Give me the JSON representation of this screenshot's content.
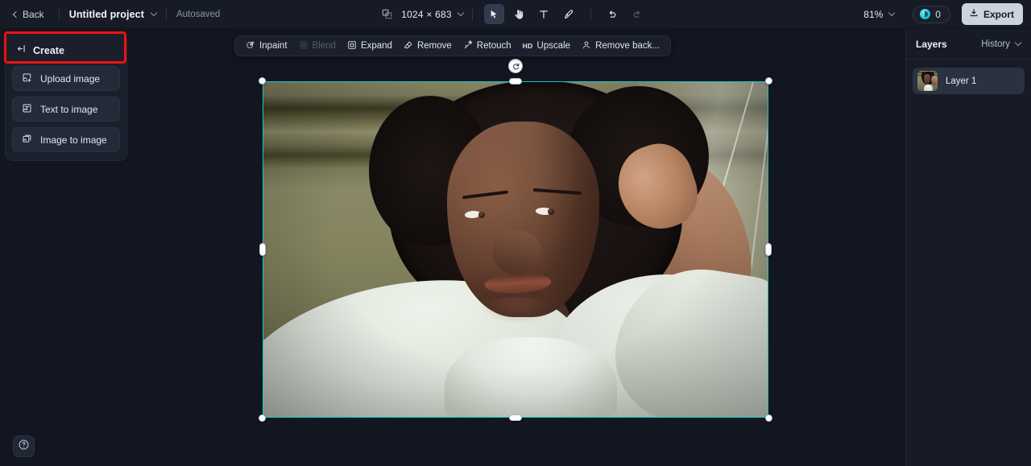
{
  "topbar": {
    "back_label": "Back",
    "project_name": "Untitled project",
    "autosaved_label": "Autosaved",
    "canvas_size": "1024 × 683",
    "zoom_level": "81%",
    "credits_count": "0",
    "export_label": "Export",
    "tools": [
      {
        "name": "select-tool",
        "glyph": "cursor",
        "active": true,
        "disabled": false
      },
      {
        "name": "pan-tool",
        "glyph": "hand",
        "active": false,
        "disabled": false
      },
      {
        "name": "text-tool",
        "glyph": "T",
        "active": false,
        "disabled": false
      },
      {
        "name": "brush-tool",
        "glyph": "brush",
        "active": false,
        "disabled": false
      },
      {
        "name": "undo-button",
        "glyph": "undo",
        "active": false,
        "disabled": false
      },
      {
        "name": "redo-button",
        "glyph": "redo",
        "active": false,
        "disabled": true
      }
    ]
  },
  "create_panel": {
    "title": "Create",
    "collapse_icon": "collapse-panel-icon",
    "items": [
      {
        "label": "Upload image",
        "icon": "image-plus-icon",
        "highlighted": true
      },
      {
        "label": "Text to image",
        "icon": "text-to-image-icon",
        "highlighted": false
      },
      {
        "label": "Image to image",
        "icon": "image-to-image-icon",
        "highlighted": false
      }
    ]
  },
  "edit_toolbar": {
    "items": [
      {
        "label": "Inpaint",
        "icon": "inpaint-icon",
        "disabled": false
      },
      {
        "label": "Blend",
        "icon": "blend-icon",
        "disabled": true
      },
      {
        "label": "Expand",
        "icon": "expand-icon",
        "disabled": false
      },
      {
        "label": "Remove",
        "icon": "eraser-icon",
        "disabled": false
      },
      {
        "label": "Retouch",
        "icon": "retouch-icon",
        "disabled": false
      },
      {
        "label": "Upscale",
        "icon": "hd-icon",
        "badge": "HD",
        "disabled": false
      },
      {
        "label": "Remove back...",
        "icon": "remove-background-icon",
        "disabled": false
      }
    ]
  },
  "canvas": {
    "selection_color": "#12c9c9",
    "rotate_handle": "rotate-handle",
    "image_alt": "Portrait of a young woman with natural afro hair wearing a white mock-neck sweater, hand raised to her hair, olive green wall background"
  },
  "layers_panel": {
    "tab_layers": "Layers",
    "tab_history": "History",
    "layers": [
      {
        "name": "Layer 1"
      }
    ]
  },
  "help": {
    "icon": "help-circle-icon"
  }
}
